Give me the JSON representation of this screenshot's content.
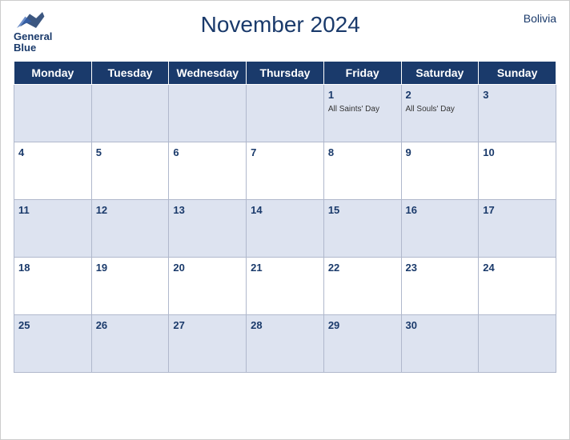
{
  "header": {
    "logo_line1": "General",
    "logo_line2": "Blue",
    "month_title": "November 2024",
    "country": "Bolivia"
  },
  "days_of_week": [
    "Monday",
    "Tuesday",
    "Wednesday",
    "Thursday",
    "Friday",
    "Saturday",
    "Sunday"
  ],
  "weeks": [
    [
      {
        "day": "",
        "events": []
      },
      {
        "day": "",
        "events": []
      },
      {
        "day": "",
        "events": []
      },
      {
        "day": "",
        "events": []
      },
      {
        "day": "1",
        "events": [
          "All Saints' Day"
        ]
      },
      {
        "day": "2",
        "events": [
          "All Souls' Day"
        ]
      },
      {
        "day": "3",
        "events": []
      }
    ],
    [
      {
        "day": "4",
        "events": []
      },
      {
        "day": "5",
        "events": []
      },
      {
        "day": "6",
        "events": []
      },
      {
        "day": "7",
        "events": []
      },
      {
        "day": "8",
        "events": []
      },
      {
        "day": "9",
        "events": []
      },
      {
        "day": "10",
        "events": []
      }
    ],
    [
      {
        "day": "11",
        "events": []
      },
      {
        "day": "12",
        "events": []
      },
      {
        "day": "13",
        "events": []
      },
      {
        "day": "14",
        "events": []
      },
      {
        "day": "15",
        "events": []
      },
      {
        "day": "16",
        "events": []
      },
      {
        "day": "17",
        "events": []
      }
    ],
    [
      {
        "day": "18",
        "events": []
      },
      {
        "day": "19",
        "events": []
      },
      {
        "day": "20",
        "events": []
      },
      {
        "day": "21",
        "events": []
      },
      {
        "day": "22",
        "events": []
      },
      {
        "day": "23",
        "events": []
      },
      {
        "day": "24",
        "events": []
      }
    ],
    [
      {
        "day": "25",
        "events": []
      },
      {
        "day": "26",
        "events": []
      },
      {
        "day": "27",
        "events": []
      },
      {
        "day": "28",
        "events": []
      },
      {
        "day": "29",
        "events": []
      },
      {
        "day": "30",
        "events": []
      },
      {
        "day": "",
        "events": []
      }
    ]
  ]
}
